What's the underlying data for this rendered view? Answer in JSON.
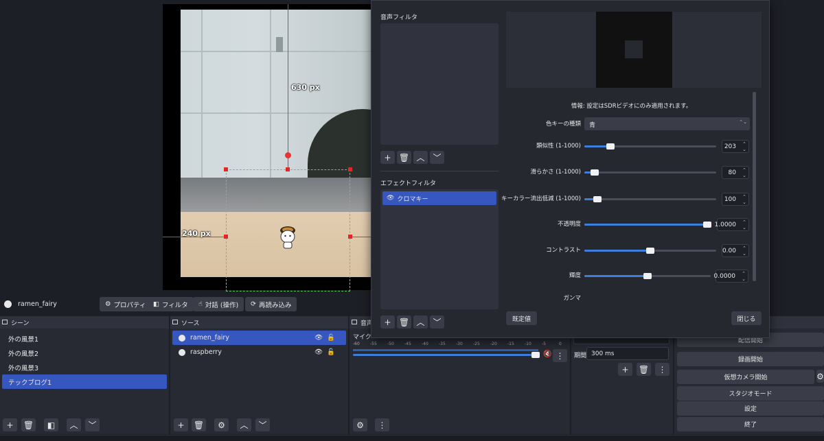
{
  "preview": {
    "vertical_guide_label": "630 px",
    "horizontal_guide_label": "240 px"
  },
  "source_toolbar": {
    "source_name": "ramen_fairy",
    "properties": "プロパティ",
    "filters": "フィルタ",
    "interact": "対話 (操作)",
    "reload": "再読み込み"
  },
  "scenes": {
    "title": "シーン",
    "items": [
      "外の風景1",
      "外の風景2",
      "外の風景3",
      "テックブログ1"
    ],
    "selected_index": 3
  },
  "sources": {
    "title": "ソース",
    "items": [
      "ramen_fairy",
      "raspberry"
    ],
    "selected_index": 0
  },
  "audio_mixer": {
    "title": "音声",
    "channel": "マイク",
    "scale": [
      "-60",
      "-55",
      "-50",
      "-45",
      "-40",
      "-35",
      "-30",
      "-25",
      "-20",
      "-15",
      "-10",
      "-5",
      "0"
    ]
  },
  "transitions": {
    "duration_label": "期間",
    "duration_value": "300 ms"
  },
  "controls": {
    "start_streaming": "配信開始",
    "start_recording": "録画開始",
    "start_virtual_camera": "仮想カメラ開始",
    "studio_mode": "スタジオモード",
    "settings": "設定",
    "exit": "終了"
  },
  "filter_dialog": {
    "audio_filters_title": "音声フィルタ",
    "effect_filters_title": "エフェクトフィルタ",
    "effect_filters": [
      "クロマキー"
    ],
    "info_text": "情報: 設定はSDRビデオにのみ適用されます。",
    "key_color_type_label": "色キーの種類",
    "key_color_type_value": "青",
    "properties": [
      {
        "label": "類似性 (1-1000)",
        "value": "203",
        "fraction": 0.2
      },
      {
        "label": "滑らかさ (1-1000)",
        "value": "80",
        "fraction": 0.08
      },
      {
        "label": "キーカラー流出低減 (1-1000)",
        "value": "100",
        "fraction": 0.1
      },
      {
        "label": "不透明度",
        "value": "1.0000",
        "fraction": 1.0
      },
      {
        "label": "コントラスト",
        "value": "0.00",
        "fraction": 0.5
      },
      {
        "label": "輝度",
        "value": "0.0000",
        "fraction": 0.5
      }
    ],
    "gamma_label": "ガンマ",
    "defaults_button": "既定値",
    "close_button": "閉じる"
  },
  "colors": {
    "selection": "#3656c0",
    "accent_slider": "#3f7fdc",
    "guide_red": "#e33333",
    "guide_green": "#5ad05a"
  }
}
